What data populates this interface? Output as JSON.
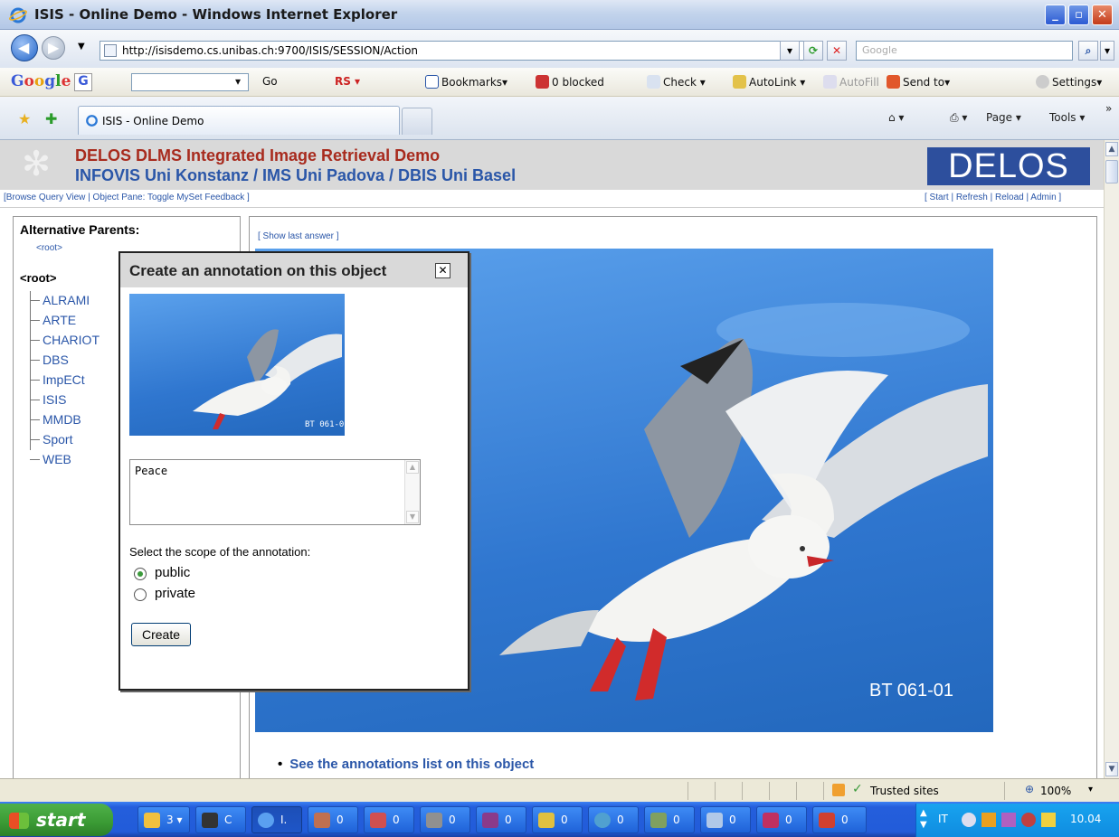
{
  "window": {
    "title": "ISIS - Online Demo - Windows Internet Explorer",
    "min": "_",
    "max": "▫",
    "close": "✕"
  },
  "address": {
    "url": "http://isisdemo.cs.unibas.ch:9700/ISIS/SESSION/Action",
    "search_placeholder": "Google",
    "search_btn": "⌕"
  },
  "google_toolbar": {
    "logo": "Google",
    "go": "Go",
    "bookmarks": "Bookmarks▾",
    "blocked": "0 blocked",
    "check": "Check ▾",
    "autolink": "AutoLink ▾",
    "autofill": "AutoFill",
    "sendto": "Send to▾",
    "settings": "Settings▾"
  },
  "tabs": {
    "active": "ISIS - Online Demo",
    "page": "Page ▾",
    "tools": "Tools ▾"
  },
  "page_header": {
    "title1": "DELOS DLMS Integrated Image Retrieval Demo",
    "title2": "INFOVIS Uni Konstanz / IMS Uni Padova / DBIS Uni Basel",
    "logo": "DELOS",
    "left_links": "[Browse Query View | Object Pane: Toggle MySet Feedback ]",
    "right_links": "[ Start | Refresh | Reload | Admin ]"
  },
  "sidebar": {
    "alt_parents": "Alternative Parents:",
    "alt_root": "<root>",
    "root": "<root>",
    "items": [
      "ALRAMI",
      "ARTE",
      "CHARIOT",
      "DBS",
      "ImpECt",
      "ISIS",
      "MMDB",
      "Sport",
      "WEB"
    ]
  },
  "main": {
    "show_last": "[ Show last answer ]",
    "image_label": "BT 061-01",
    "annotations_link": "See the annotations list on this object"
  },
  "dialog": {
    "title": "Create an annotation on this object",
    "close": "✕",
    "thumb_label": "BT 061-01",
    "text": "Peace",
    "scope_label": "Select the scope of the annotation:",
    "opt_public": "public",
    "opt_private": "private",
    "selected": "public",
    "create": "Create"
  },
  "status": {
    "zone": "Trusted sites",
    "zoom": "100%"
  },
  "taskbar": {
    "start": "start",
    "tasks": [
      "3 ▾",
      "C",
      "I.",
      "0",
      "0",
      "0",
      "0",
      "0",
      "0",
      "0",
      "0",
      "0",
      "0"
    ],
    "lang": "ΙΤ",
    "clock": "10.04"
  },
  "colors": {
    "title_red": "#a82b1e",
    "link_blue": "#2a56a8",
    "xp_blue": "#245edc",
    "start_green": "#3a9a34"
  }
}
